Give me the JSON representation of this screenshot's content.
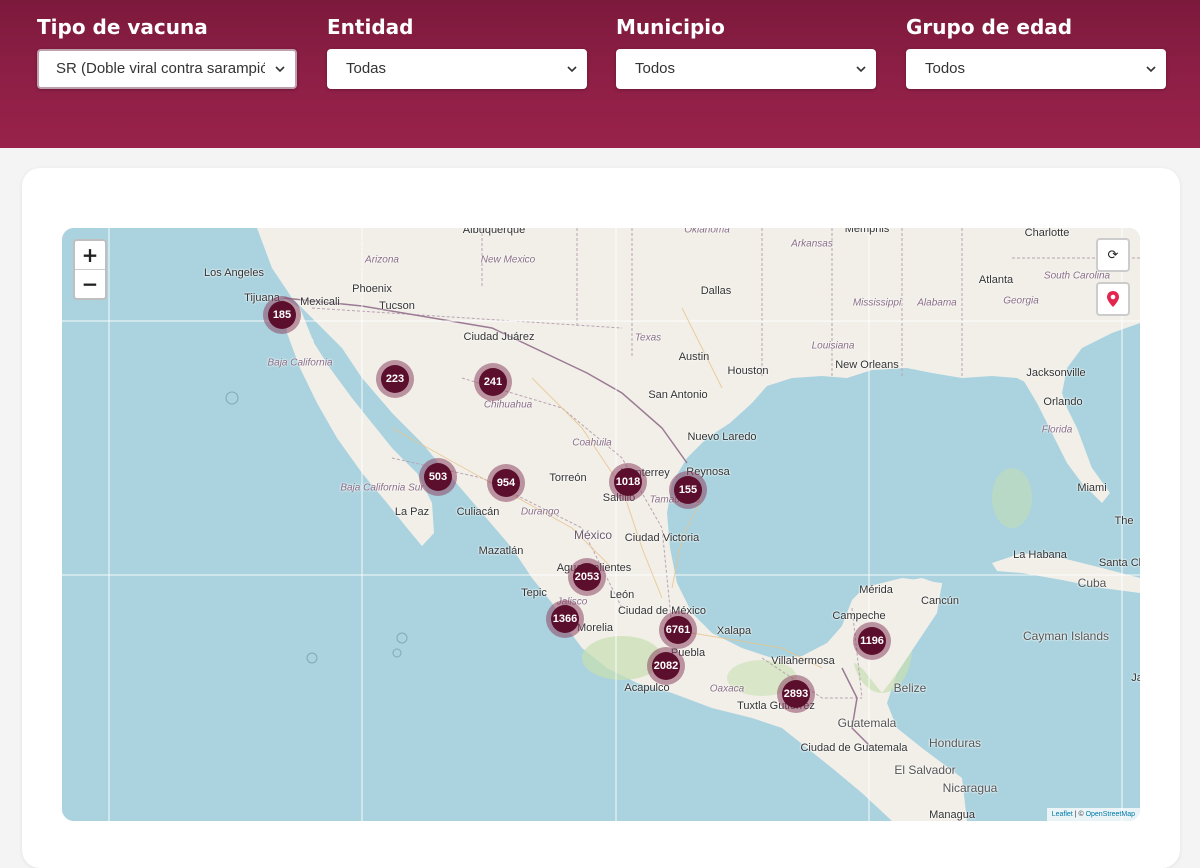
{
  "filters": {
    "vaccine": {
      "label": "Tipo de vacuna",
      "value": "SR (Doble viral contra sarampión)"
    },
    "entity": {
      "label": "Entidad",
      "value": "Todas"
    },
    "municipality": {
      "label": "Municipio",
      "value": "Todos"
    },
    "age_group": {
      "label": "Grupo de edad",
      "value": "Todos"
    }
  },
  "map": {
    "controls": {
      "zoom_in": "+",
      "zoom_out": "−",
      "reset": "⟳"
    },
    "attribution": {
      "leaflet": "Leaflet",
      "separator": " | © ",
      "osm": "OpenStreetMap"
    },
    "clusters": [
      {
        "id": "tijuana",
        "count": "185"
      },
      {
        "id": "sonora",
        "count": "223"
      },
      {
        "id": "chihuahua",
        "count": "241"
      },
      {
        "id": "sinaloa",
        "count": "503"
      },
      {
        "id": "durango",
        "count": "954"
      },
      {
        "id": "nuevo-leon",
        "count": "1018"
      },
      {
        "id": "tamaulipas",
        "count": "155"
      },
      {
        "id": "aguascalientes",
        "count": "2053"
      },
      {
        "id": "jalisco",
        "count": "1366"
      },
      {
        "id": "cdmx",
        "count": "6761"
      },
      {
        "id": "guerrero",
        "count": "2082"
      },
      {
        "id": "yucatan",
        "count": "1196"
      },
      {
        "id": "chiapas",
        "count": "2893"
      }
    ],
    "place_labels": [
      "Albuquerque",
      "Oklahoma",
      "Memphis",
      "Charlotte",
      "Los Angeles",
      "Arizona",
      "New Mexico",
      "Arkansas",
      "Phoenix",
      "Tijuana",
      "Mexicali",
      "Tucson",
      "Dallas",
      "Atlanta",
      "South Carolina",
      "Mississippi",
      "Alabama",
      "Georgia",
      "Ciudad Juárez",
      "Texas",
      "Louisiana",
      "Austin",
      "Houston",
      "New Orleans",
      "Jacksonville",
      "Baja California",
      "Chihuahua",
      "San Antonio",
      "Orlando",
      "Florida",
      "Coahuila",
      "Nuevo Laredo",
      "Reynosa",
      "Torreón",
      "Monterrey",
      "Saltillo",
      "Tamaulipas",
      "Miami",
      "Baja California Sur",
      "La Paz",
      "Culiacán",
      "Durango",
      "México",
      "Ciudad Victoria",
      "The",
      "Mazatlán",
      "Aguascalientes",
      "La Habana",
      "Santa Cl",
      "Cuba",
      "Tepic",
      "León",
      "Mérida",
      "Cancún",
      "Jalisco",
      "Ciudad de México",
      "Morelia",
      "Xalapa",
      "Campeche",
      "Cayman Islands",
      "Puebla",
      "Villahermosa",
      "Acapulco",
      "Oaxaca",
      "Belize",
      "Tuxtla Gutiérrez",
      "Ja",
      "Guatemala",
      "Ciudad de Guatemala",
      "Honduras",
      "El Salvador",
      "Nicaragua",
      "Managua"
    ]
  }
}
